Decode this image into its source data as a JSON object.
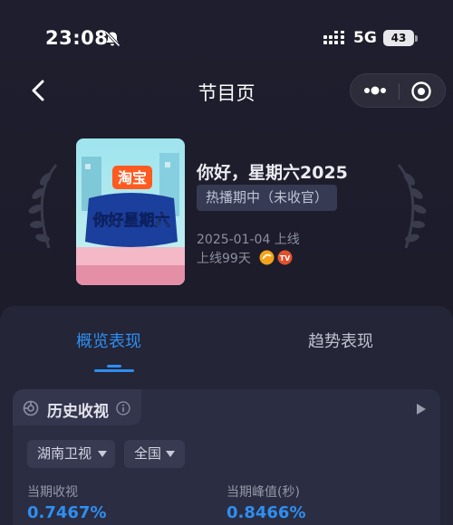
{
  "status_bar": {
    "time": "23:08",
    "network": "5G",
    "battery": "43",
    "icons": [
      "bell-muted-icon",
      "signal-icon",
      "battery-icon"
    ]
  },
  "nav": {
    "title": "节目页",
    "icons": [
      "back-arrow-icon",
      "more-dots-icon",
      "close-circle-icon"
    ]
  },
  "show": {
    "name": "你好，星期六2025",
    "status_badge": "热播期中（未收官）",
    "premiere": "2025-01-04 上线",
    "days_online": "上线99天",
    "poster_brand": "淘宝",
    "poster_title": "你好星期六",
    "platform_icons": [
      "mango-tv-icon",
      "hunan-tv-icon"
    ]
  },
  "tabs": [
    {
      "label": "概览表现",
      "active": true
    },
    {
      "label": "趋势表现",
      "active": false
    }
  ],
  "card": {
    "title": "历史收视",
    "filters": {
      "channel": "湖南卫视",
      "region": "全国"
    },
    "metrics": [
      {
        "label": "当期收视",
        "value": "0.7467%"
      },
      {
        "label": "当期峰值(秒)",
        "value": "0.8466%"
      }
    ]
  },
  "colors": {
    "accent": "#2f8ef0",
    "background": "#1c1c2c",
    "panel": "#242537"
  }
}
